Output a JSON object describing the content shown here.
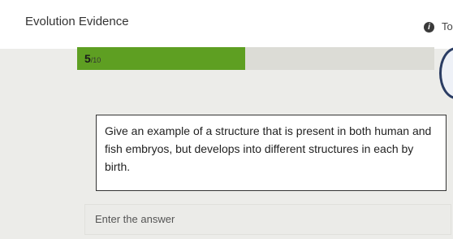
{
  "header": {
    "title": "Evolution Evidence",
    "info_icon": "info-icon",
    "right_text": "To"
  },
  "progress": {
    "current": "5",
    "total_label": "/10",
    "fill_fraction": 0.47,
    "fill_color": "#5e9f22"
  },
  "question": {
    "text": "Give an example of a structure that is present in both human and fish embryos, but develops into different structures in each by birth."
  },
  "answer": {
    "placeholder": "Enter the answer"
  }
}
